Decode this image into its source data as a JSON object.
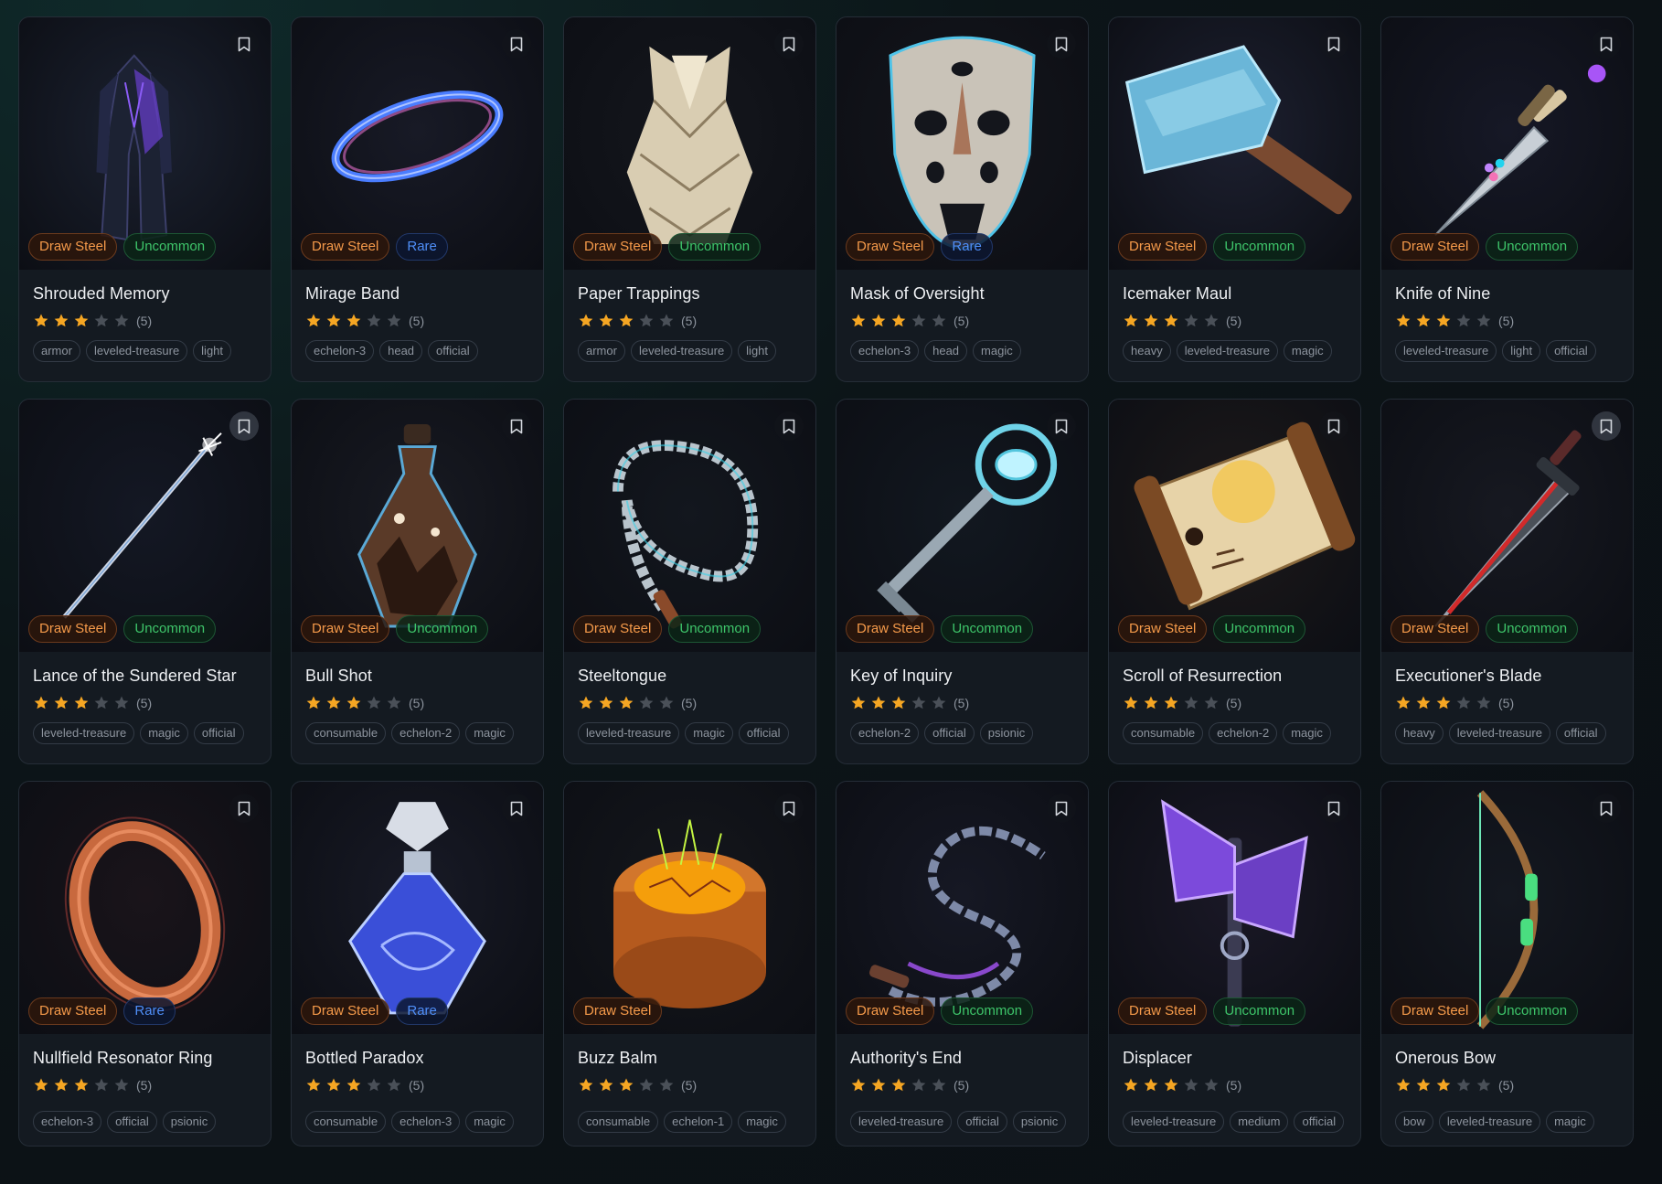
{
  "items": [
    {
      "title": "Shrouded Memory",
      "system": "Draw Steel",
      "rarity": "Uncommon",
      "rarity_class": "uncommon",
      "rating": 3,
      "rating_count": "(5)",
      "tags": [
        "armor",
        "leveled-treasure",
        "light"
      ],
      "icon": "coat-icon",
      "bookmarked": false
    },
    {
      "title": "Mirage Band",
      "system": "Draw Steel",
      "rarity": "Rare",
      "rarity_class": "rare",
      "rating": 3,
      "rating_count": "(5)",
      "tags": [
        "echelon-3",
        "head",
        "official"
      ],
      "icon": "band-icon",
      "bookmarked": false
    },
    {
      "title": "Paper Trappings",
      "system": "Draw Steel",
      "rarity": "Uncommon",
      "rarity_class": "uncommon",
      "rating": 3,
      "rating_count": "(5)",
      "tags": [
        "armor",
        "leveled-treasure",
        "light"
      ],
      "icon": "paper-armor-icon",
      "bookmarked": false
    },
    {
      "title": "Mask of Oversight",
      "system": "Draw Steel",
      "rarity": "Rare",
      "rarity_class": "rare",
      "rating": 3,
      "rating_count": "(5)",
      "tags": [
        "echelon-3",
        "head",
        "magic"
      ],
      "icon": "mask-icon",
      "bookmarked": false
    },
    {
      "title": "Icemaker Maul",
      "system": "Draw Steel",
      "rarity": "Uncommon",
      "rarity_class": "uncommon",
      "rating": 3,
      "rating_count": "(5)",
      "tags": [
        "heavy",
        "leveled-treasure",
        "magic"
      ],
      "icon": "maul-icon",
      "bookmarked": false
    },
    {
      "title": "Knife of Nine",
      "system": "Draw Steel",
      "rarity": "Uncommon",
      "rarity_class": "uncommon",
      "rating": 3,
      "rating_count": "(5)",
      "tags": [
        "leveled-treasure",
        "light",
        "official"
      ],
      "icon": "knife-icon",
      "bookmarked": false
    },
    {
      "title": "Lance of the Sundered Star",
      "system": "Draw Steel",
      "rarity": "Uncommon",
      "rarity_class": "uncommon",
      "rating": 3,
      "rating_count": "(5)",
      "tags": [
        "leveled-treasure",
        "magic",
        "official"
      ],
      "icon": "lance-icon",
      "bookmarked": true
    },
    {
      "title": "Bull Shot",
      "system": "Draw Steel",
      "rarity": "Uncommon",
      "rarity_class": "uncommon",
      "rating": 3,
      "rating_count": "(5)",
      "tags": [
        "consumable",
        "echelon-2",
        "magic"
      ],
      "icon": "flask-icon",
      "bookmarked": false
    },
    {
      "title": "Steeltongue",
      "system": "Draw Steel",
      "rarity": "Uncommon",
      "rarity_class": "uncommon",
      "rating": 3,
      "rating_count": "(5)",
      "tags": [
        "leveled-treasure",
        "magic",
        "official"
      ],
      "icon": "whip-icon",
      "bookmarked": false
    },
    {
      "title": "Key of Inquiry",
      "system": "Draw Steel",
      "rarity": "Uncommon",
      "rarity_class": "uncommon",
      "rating": 3,
      "rating_count": "(5)",
      "tags": [
        "echelon-2",
        "official",
        "psionic"
      ],
      "icon": "key-icon",
      "bookmarked": false
    },
    {
      "title": "Scroll of Resurrection",
      "system": "Draw Steel",
      "rarity": "Uncommon",
      "rarity_class": "uncommon",
      "rating": 3,
      "rating_count": "(5)",
      "tags": [
        "consumable",
        "echelon-2",
        "magic"
      ],
      "icon": "scroll-icon",
      "bookmarked": false
    },
    {
      "title": "Executioner's Blade",
      "system": "Draw Steel",
      "rarity": "Uncommon",
      "rarity_class": "uncommon",
      "rating": 3,
      "rating_count": "(5)",
      "tags": [
        "heavy",
        "leveled-treasure",
        "official"
      ],
      "icon": "sword-icon",
      "bookmarked": true
    },
    {
      "title": "Nullfield Resonator Ring",
      "system": "Draw Steel",
      "rarity": "Rare",
      "rarity_class": "rare",
      "rating": 3,
      "rating_count": "(5)",
      "tags": [
        "echelon-3",
        "official",
        "psionic"
      ],
      "icon": "ring-icon",
      "bookmarked": false
    },
    {
      "title": "Bottled Paradox",
      "system": "Draw Steel",
      "rarity": "Rare",
      "rarity_class": "rare",
      "rating": 3,
      "rating_count": "(5)",
      "tags": [
        "consumable",
        "echelon-3",
        "magic"
      ],
      "icon": "bottle-icon",
      "bookmarked": false
    },
    {
      "title": "Buzz Balm",
      "system": "Draw Steel",
      "rarity": "",
      "rarity_class": "",
      "rating": 3,
      "rating_count": "(5)",
      "tags": [
        "consumable",
        "echelon-1",
        "magic"
      ],
      "icon": "balm-jar-icon",
      "bookmarked": false
    },
    {
      "title": "Authority's End",
      "system": "Draw Steel",
      "rarity": "Uncommon",
      "rarity_class": "uncommon",
      "rating": 3,
      "rating_count": "(5)",
      "tags": [
        "leveled-treasure",
        "official",
        "psionic"
      ],
      "icon": "chain-icon",
      "bookmarked": false
    },
    {
      "title": "Displacer",
      "system": "Draw Steel",
      "rarity": "Uncommon",
      "rarity_class": "uncommon",
      "rating": 3,
      "rating_count": "(5)",
      "tags": [
        "leveled-treasure",
        "medium",
        "official"
      ],
      "icon": "axe-icon",
      "bookmarked": false
    },
    {
      "title": "Onerous Bow",
      "system": "Draw Steel",
      "rarity": "Uncommon",
      "rarity_class": "uncommon",
      "rating": 3,
      "rating_count": "(5)",
      "tags": [
        "bow",
        "leveled-treasure",
        "magic"
      ],
      "icon": "bow-icon",
      "bookmarked": false
    }
  ],
  "max_rating": 5,
  "colors": {
    "star_filled": "#f5a623",
    "star_empty": "#4a5058",
    "uncommon": "#3ec56a",
    "rare": "#4f8ef7",
    "system": "#f59a4a"
  }
}
